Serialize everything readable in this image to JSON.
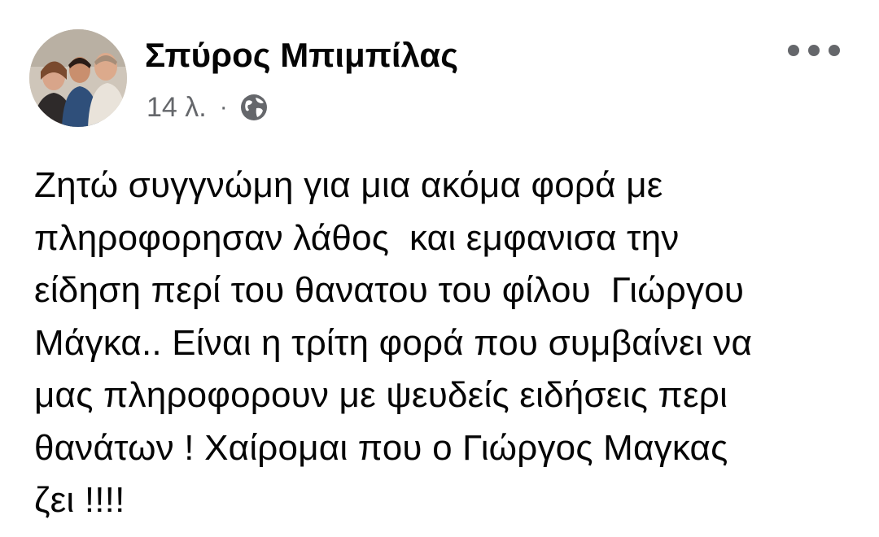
{
  "post": {
    "author_name": "Σπύρος Μπιμπίλας",
    "timestamp": "14 λ.",
    "separator": "·",
    "privacy_icon": "globe-icon",
    "more_icon": "more-options-icon",
    "text_lines": [
      "Ζητώ συγγνώμη για μια ακόμα φορά με",
      "πληροφορησαν λάθος  και εμφανισα την",
      "είδηση περί του θανατου του φίλου  Γιώργου",
      "Μάγκα.. Είναι η τρίτη φορά που συμβαίνει να",
      "μας πληροφορουν με ψευδείς ειδήσεις περι",
      "θανάτων ! Χαίρομαι που ο Γιώργος Μαγκας",
      "ζει !!!!"
    ]
  },
  "colors": {
    "text": "#050505",
    "secondary_text": "#65676b",
    "background": "#ffffff"
  }
}
